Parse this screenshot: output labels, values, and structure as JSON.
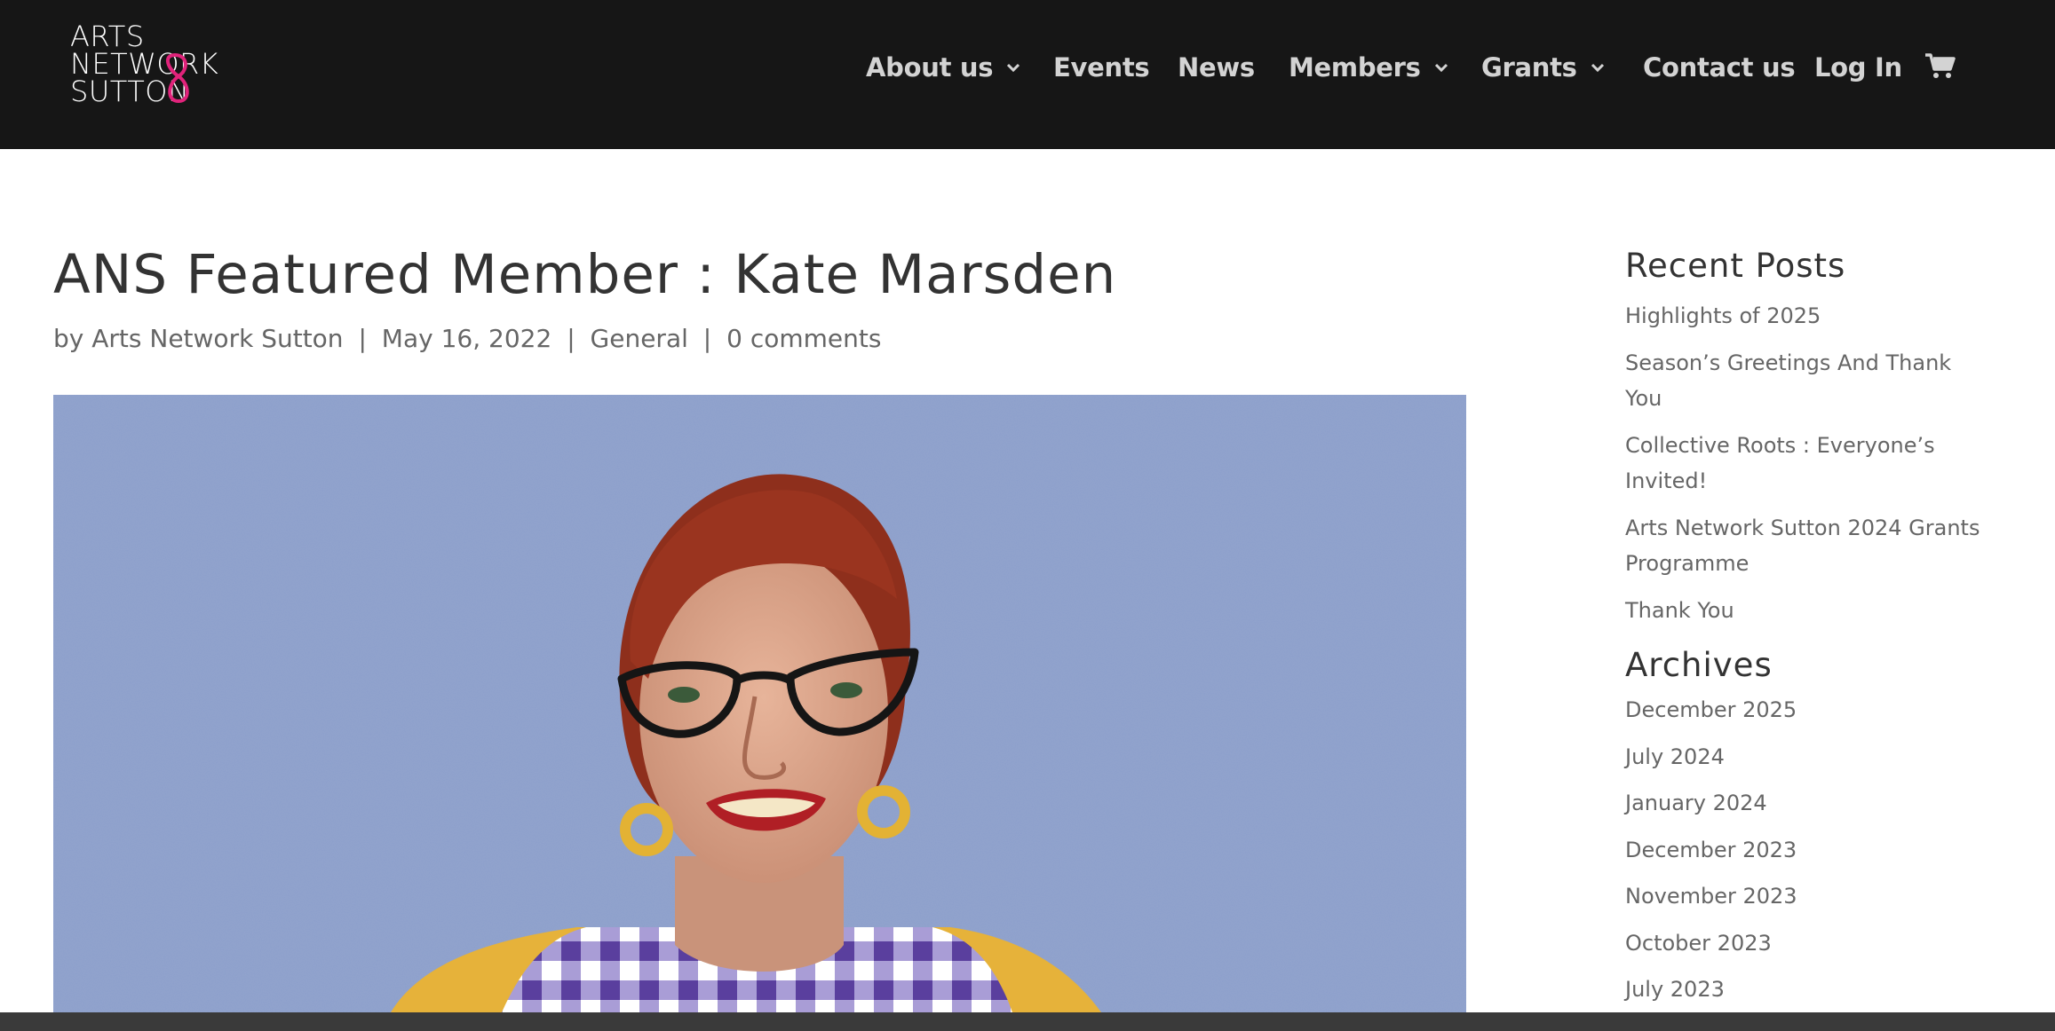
{
  "logo": {
    "lines": [
      "ARTS",
      "NETWORK",
      "SUTTON"
    ],
    "accent_color": "#e1237b"
  },
  "nav": {
    "items": [
      {
        "label": "About us",
        "has_dropdown": true
      },
      {
        "label": "Events",
        "has_dropdown": false
      },
      {
        "label": "News",
        "has_dropdown": false
      },
      {
        "label": "Members",
        "has_dropdown": true
      },
      {
        "label": "Grants",
        "has_dropdown": true
      },
      {
        "label": "Contact us",
        "has_dropdown": false
      },
      {
        "label": "Log In",
        "has_dropdown": false
      }
    ],
    "cart_icon": "shopping-cart-icon"
  },
  "post": {
    "title": "ANS Featured Member : Kate Marsden",
    "meta": {
      "by": "by",
      "author": "Arts Network Sutton",
      "separator": "|",
      "date": "May 16, 2022",
      "category": "General",
      "comments": "0 comments"
    }
  },
  "sidebar": {
    "recent_posts": {
      "title": "Recent Posts",
      "items": [
        "Highlights of 2025",
        "Season’s Greetings And Thank You",
        "Collective Roots : Everyone’s Invited!",
        "Arts Network Sutton 2024 Grants Programme",
        "Thank You"
      ]
    },
    "archives": {
      "title": "Archives",
      "items": [
        "December 2025",
        "July 2024",
        "January 2024",
        "December 2023",
        "November 2023",
        "October 2023",
        "July 2023"
      ]
    }
  },
  "colors": {
    "header_bg": "#161616",
    "nav_text": "#d3d3d3",
    "photo_wall": "#8c9fcc",
    "bottom_bar": "#3a3a3a"
  }
}
